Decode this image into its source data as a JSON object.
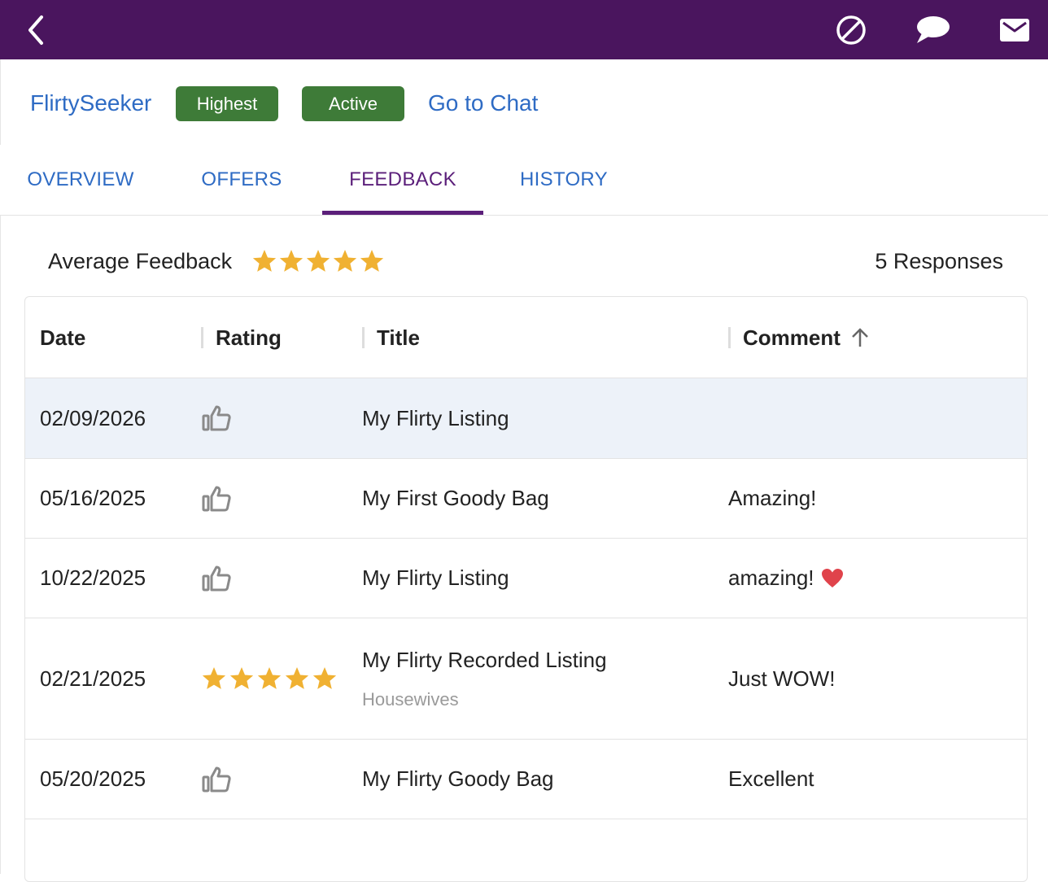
{
  "nav": {
    "back_icon": "chevron-left-icon",
    "block_icon": "block-icon",
    "chat_icon": "chat-bubble-icon",
    "mail_icon": "mail-icon"
  },
  "profile": {
    "username": "FlirtySeeker",
    "badges": [
      "Highest",
      "Active"
    ],
    "chat_link": "Go to Chat"
  },
  "tabs": [
    {
      "label": "OVERVIEW",
      "active": false
    },
    {
      "label": "OFFERS",
      "active": false
    },
    {
      "label": "FEEDBACK",
      "active": true
    },
    {
      "label": "HISTORY",
      "active": false
    }
  ],
  "summary": {
    "label": "Average Feedback",
    "rating_stars": 5,
    "responses": "5 Responses"
  },
  "table": {
    "columns": [
      "Date",
      "Rating",
      "Title",
      "Comment"
    ],
    "sort_column": "Comment",
    "sort_direction": "ascending",
    "rows": [
      {
        "date": "02/09/2026",
        "rating": "thumbs-up",
        "title": "My Flirty Listing",
        "subtitle": "",
        "comment": "",
        "heart": false
      },
      {
        "date": "05/16/2025",
        "rating": "thumbs-up",
        "title": "My First Goody Bag",
        "subtitle": "",
        "comment": "Amazing!",
        "heart": false
      },
      {
        "date": "10/22/2025",
        "rating": "thumbs-up",
        "title": "My Flirty Listing",
        "subtitle": "",
        "comment": "amazing!",
        "heart": true
      },
      {
        "date": "02/21/2025",
        "rating": "5-stars",
        "title": "My Flirty Recorded Listing",
        "subtitle": "Housewives",
        "comment": "Just WOW!",
        "heart": false
      },
      {
        "date": "05/20/2025",
        "rating": "thumbs-up",
        "title": "My Flirty Goody Bag",
        "subtitle": "",
        "comment": "Excellent",
        "heart": false
      }
    ]
  },
  "colors": {
    "topbar": "#4a155e",
    "link": "#2e6bc4",
    "badge": "#3e7b38",
    "active_tab": "#5b1f7a",
    "star": "#f0b132",
    "selected_row": "#edf2f9"
  }
}
